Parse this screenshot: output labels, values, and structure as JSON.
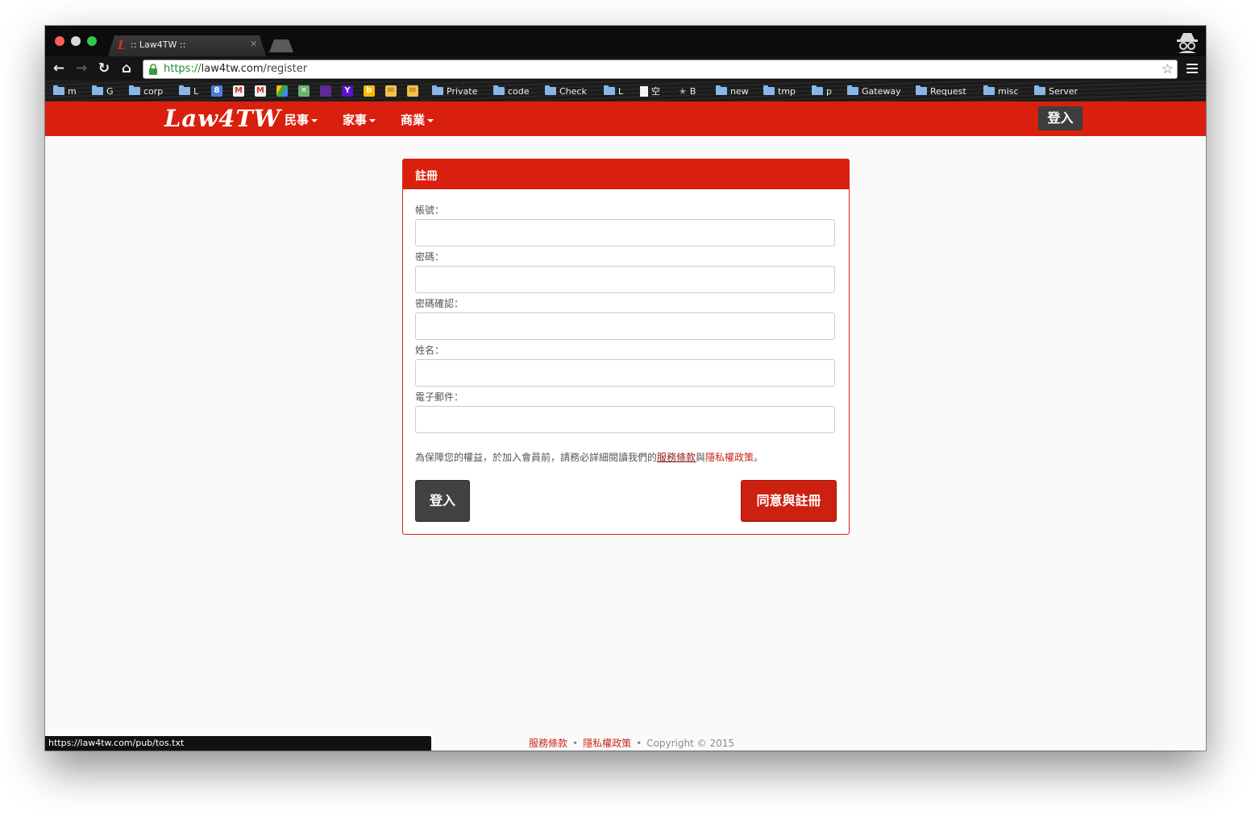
{
  "browser": {
    "tab_title": ":: Law4TW ::",
    "tab_favicon": "L",
    "url_scheme": "https://",
    "url_host": "law4tw.com",
    "url_path": "/register",
    "bookmarks": [
      {
        "label": "m",
        "icon": "folder-icon"
      },
      {
        "label": "G",
        "icon": "folder-icon"
      },
      {
        "label": "corp",
        "icon": "folder-icon"
      },
      {
        "label": "L",
        "icon": "folder-icon"
      },
      {
        "label": "Private",
        "icon": "folder-icon"
      },
      {
        "label": "code",
        "icon": "folder-icon"
      },
      {
        "label": "Check",
        "icon": "folder-icon"
      },
      {
        "label": "L",
        "icon": "folder-icon"
      },
      {
        "label": "空",
        "icon": "page-icon"
      },
      {
        "label": "B",
        "icon": "star-icon"
      },
      {
        "label": "new",
        "icon": "folder-icon"
      },
      {
        "label": "tmp",
        "icon": "folder-icon"
      },
      {
        "label": "p",
        "icon": "folder-icon"
      },
      {
        "label": "Gateway",
        "icon": "folder-icon"
      },
      {
        "label": "Request",
        "icon": "folder-icon"
      },
      {
        "label": "misc",
        "icon": "folder-icon"
      },
      {
        "label": "Server",
        "icon": "folder-icon"
      }
    ],
    "status_url": "https://law4tw.com/pub/tos.txt"
  },
  "site": {
    "logo": "Law4TW",
    "nav": [
      "民事",
      "家事",
      "商業"
    ],
    "login_label": "登入",
    "brand_color": "#d9200f"
  },
  "form": {
    "title": "註冊",
    "fields": [
      {
        "label": "帳號：",
        "value": ""
      },
      {
        "label": "密碼：",
        "value": ""
      },
      {
        "label": "密碼確認：",
        "value": ""
      },
      {
        "label": "姓名：",
        "value": ""
      },
      {
        "label": "電子郵件：",
        "value": ""
      }
    ],
    "notice_prefix": "為保障您的權益，於加入會員前，請務必詳細閱讀我們的",
    "tos_link": "服務條款",
    "notice_and": "與",
    "privacy_link": "隱私權政策",
    "notice_suffix": "。",
    "login_button": "登入",
    "register_button": "同意與註冊"
  },
  "footer": {
    "tos": "服務條款",
    "privacy": "隱私權政策",
    "copyright": "Copyright © 2015",
    "separator": "•"
  }
}
